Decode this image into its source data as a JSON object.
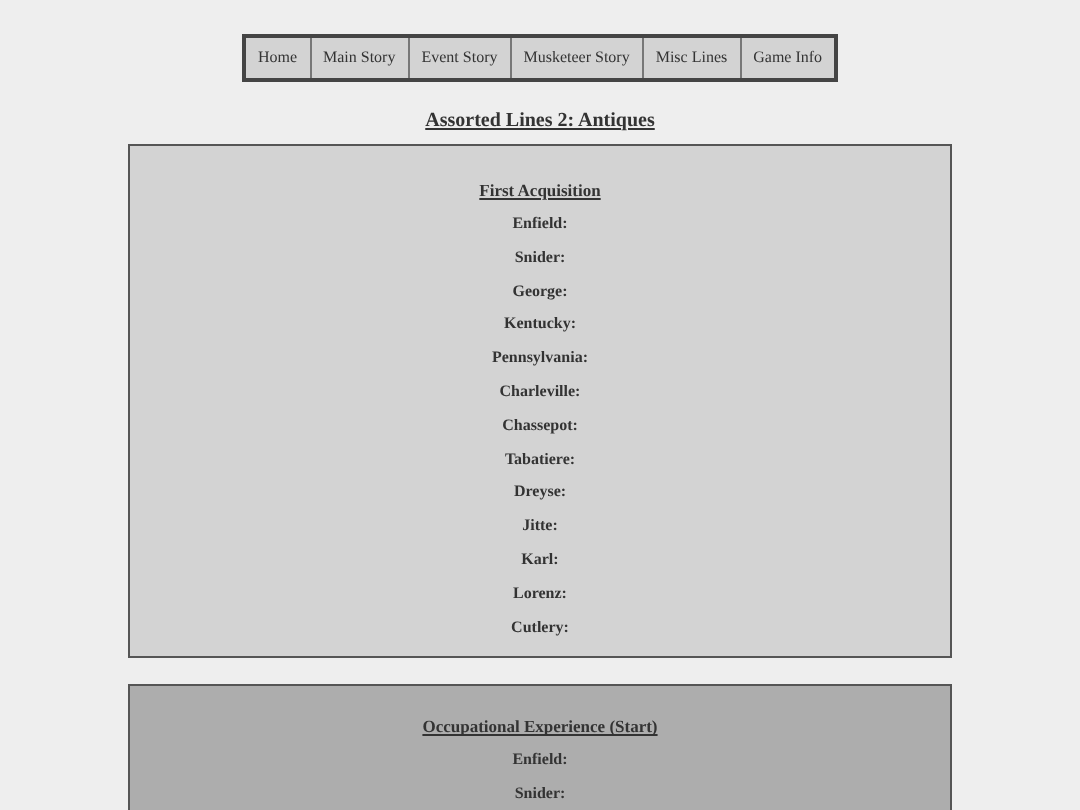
{
  "nav": [
    {
      "label": "Home"
    },
    {
      "label": "Main Story"
    },
    {
      "label": "Event Story"
    },
    {
      "label": "Musketeer Story"
    },
    {
      "label": "Misc Lines"
    },
    {
      "label": "Game Info"
    }
  ],
  "page_title": "Assorted Lines 2: Antiques",
  "sections": [
    {
      "kind": "light",
      "heading": "First Acquisition",
      "lines": [
        "Enfield:",
        "Snider:",
        "George:",
        "Kentucky:",
        "Pennsylvania:",
        "Charleville:",
        "Chassepot:",
        "Tabatiere:",
        "Dreyse:",
        "Jitte:",
        "Karl:",
        "Lorenz:",
        "Cutlery:"
      ]
    },
    {
      "kind": "dark",
      "heading": "Occupational Experience (Start)",
      "lines": [
        "Enfield:",
        "Snider:"
      ]
    }
  ]
}
